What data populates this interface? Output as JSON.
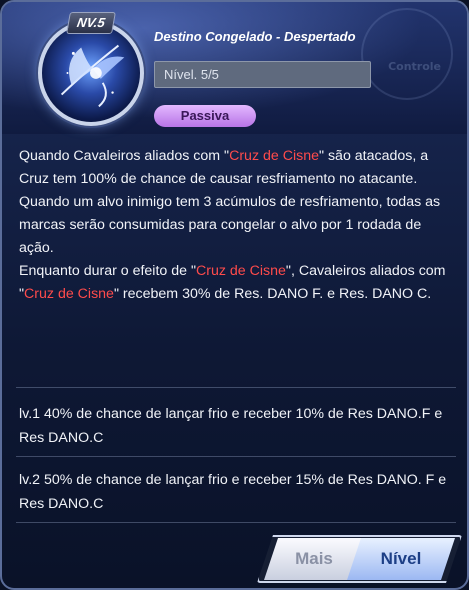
{
  "header": {
    "level_badge": "NV.5",
    "skill_name": "Destino Congelado - Despertado",
    "level_field_value": "Nível. 5/5",
    "type_tag": "Passiva",
    "background_text": "Controle"
  },
  "description": {
    "p1_a": "Quando Cavaleiros aliados com \"",
    "p1_hl": "Cruz de Cisne",
    "p1_b": "\" são atacados, a Cruz tem 100% de chance de causar resfriamento no atacante. Quando um alvo inimigo tem 3 acúmulos de resfriamento, todas as marcas serão consumidas para congelar o alvo por 1 rodada de ação.",
    "p2_a": "Enquanto durar o efeito de \"",
    "p2_hl1": "Cruz de Cisne",
    "p2_b": "\", Cavaleiros aliados com \"",
    "p2_hl2": "Cruz de Cisne",
    "p2_c": "\" recebem 30% de Res. DANO F. e Res. DANO C."
  },
  "levels": [
    {
      "text": "lv.1 40% de chance de lançar frio e receber 10% de Res DANO.F e Res DANO.C"
    },
    {
      "text": "lv.2 50% de chance de lançar frio e receber 15% de Res DANO. F e Res DANO.C"
    }
  ],
  "buttons": {
    "more": "Mais",
    "level": "Nível"
  },
  "colors": {
    "highlight": "#ff4b4b",
    "passive_tag": "#c88af0",
    "panel": "#101b40"
  },
  "icons": {
    "skill_emblem": "swan-cross-icon"
  }
}
